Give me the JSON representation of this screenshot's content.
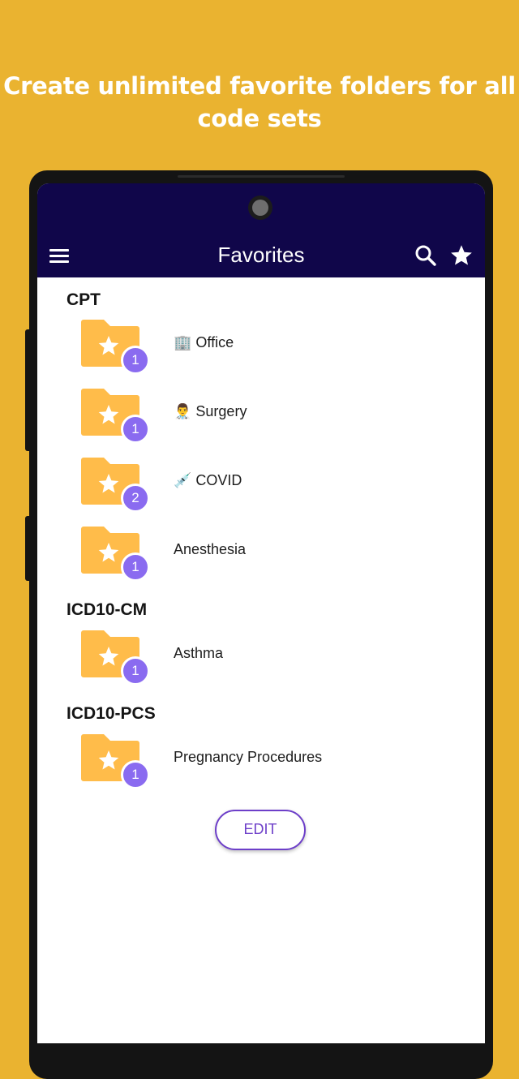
{
  "promo": {
    "headline": "Create unlimited favorite folders for all code sets"
  },
  "app_bar": {
    "title": "Favorites",
    "menu_icon": "hamburger-menu-icon",
    "search_icon": "search-icon",
    "star_icon": "star-icon"
  },
  "colors": {
    "background": "#EAB330",
    "app_bar": "#10064A",
    "folder": "#FFBC4A",
    "badge": "#8A6BF0",
    "edit_button": "#6D3FC9"
  },
  "sections": [
    {
      "title": "CPT",
      "items": [
        {
          "label": "🏢 Office",
          "count": "1"
        },
        {
          "label": "👨‍⚕️ Surgery",
          "count": "1"
        },
        {
          "label": "💉 COVID",
          "count": "2"
        },
        {
          "label": "Anesthesia",
          "count": "1"
        }
      ]
    },
    {
      "title": "ICD10-CM",
      "items": [
        {
          "label": "Asthma",
          "count": "1"
        }
      ]
    },
    {
      "title": "ICD10-PCS",
      "items": [
        {
          "label": "Pregnancy Procedures",
          "count": "1"
        }
      ]
    }
  ],
  "edit_button": {
    "label": "EDIT"
  }
}
